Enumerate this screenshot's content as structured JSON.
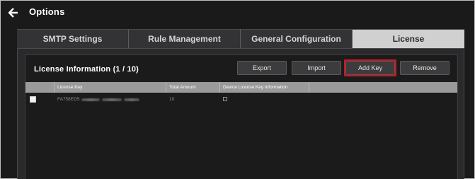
{
  "header": {
    "title": "Options"
  },
  "tabs": [
    {
      "label": "SMTP Settings",
      "active": false
    },
    {
      "label": "Rule Management",
      "active": false
    },
    {
      "label": "General Configuration",
      "active": false
    },
    {
      "label": "License",
      "active": true
    }
  ],
  "license": {
    "title": "License Information (1 / 10)",
    "buttons": {
      "export": "Export",
      "import": "Import",
      "add_key": "Add Key",
      "remove": "Remove"
    },
    "highlight_color": "#d2141f",
    "table": {
      "columns": [
        "License Key",
        "Total Amount",
        "Device License Key Information"
      ],
      "rows": [
        {
          "key_prefix": "FA758ED5",
          "total_amount": "10",
          "device_info_icon": "square-outline-icon",
          "checked": false
        }
      ]
    }
  },
  "colors": {
    "background": "#1a1a1b",
    "active_tab": "#d0d0d0",
    "table_header": "#9a9a9a"
  }
}
